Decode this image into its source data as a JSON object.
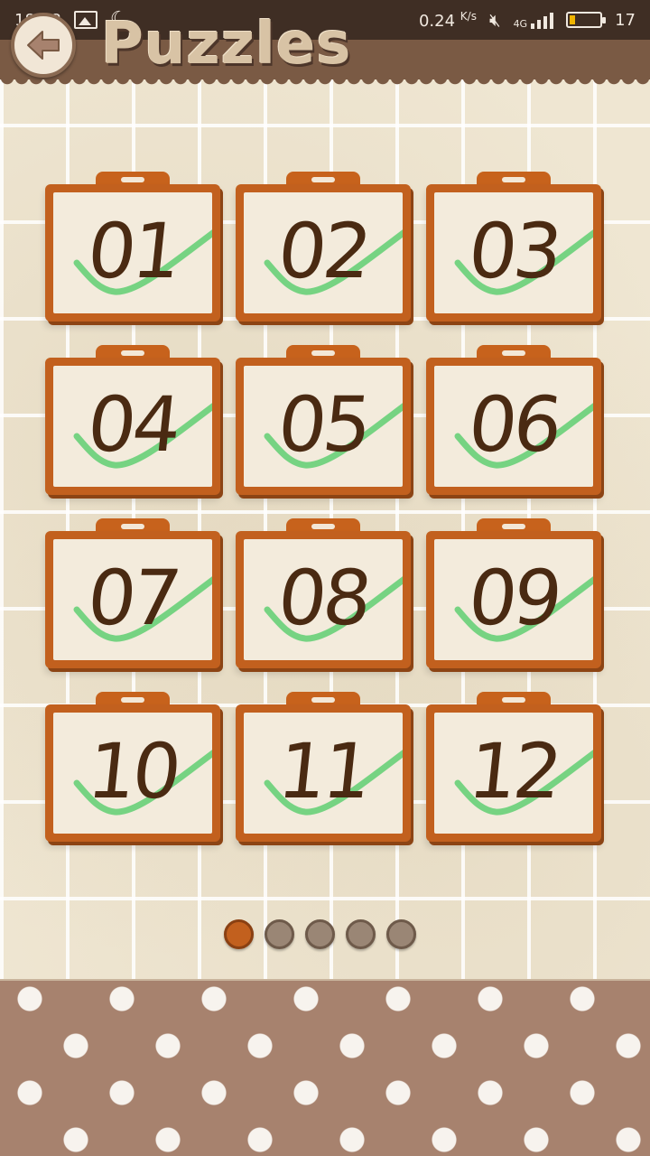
{
  "status_bar": {
    "time": "18:28",
    "speed": "0.24",
    "speed_unit": "K/s",
    "network": "4G",
    "battery": "17"
  },
  "header": {
    "title": "Puzzles",
    "back_icon": "back-arrow-icon"
  },
  "puzzles": [
    {
      "label": "01",
      "solved": true
    },
    {
      "label": "02",
      "solved": true
    },
    {
      "label": "03",
      "solved": true
    },
    {
      "label": "04",
      "solved": true
    },
    {
      "label": "05",
      "solved": true
    },
    {
      "label": "06",
      "solved": true
    },
    {
      "label": "07",
      "solved": true
    },
    {
      "label": "08",
      "solved": true
    },
    {
      "label": "09",
      "solved": true
    },
    {
      "label": "10",
      "solved": true
    },
    {
      "label": "11",
      "solved": true
    },
    {
      "label": "12",
      "solved": true
    }
  ],
  "pagination": {
    "total_pages": 5,
    "current_page": 1
  },
  "colors": {
    "header_brown": "#7a5a44",
    "tile_orange": "#c2601e",
    "check_green": "#5fcf72",
    "number_brown": "#4a2a12",
    "dot_active": "#c2601e",
    "dot_inactive": "#9a8675",
    "polka_bg": "#a7826e"
  }
}
